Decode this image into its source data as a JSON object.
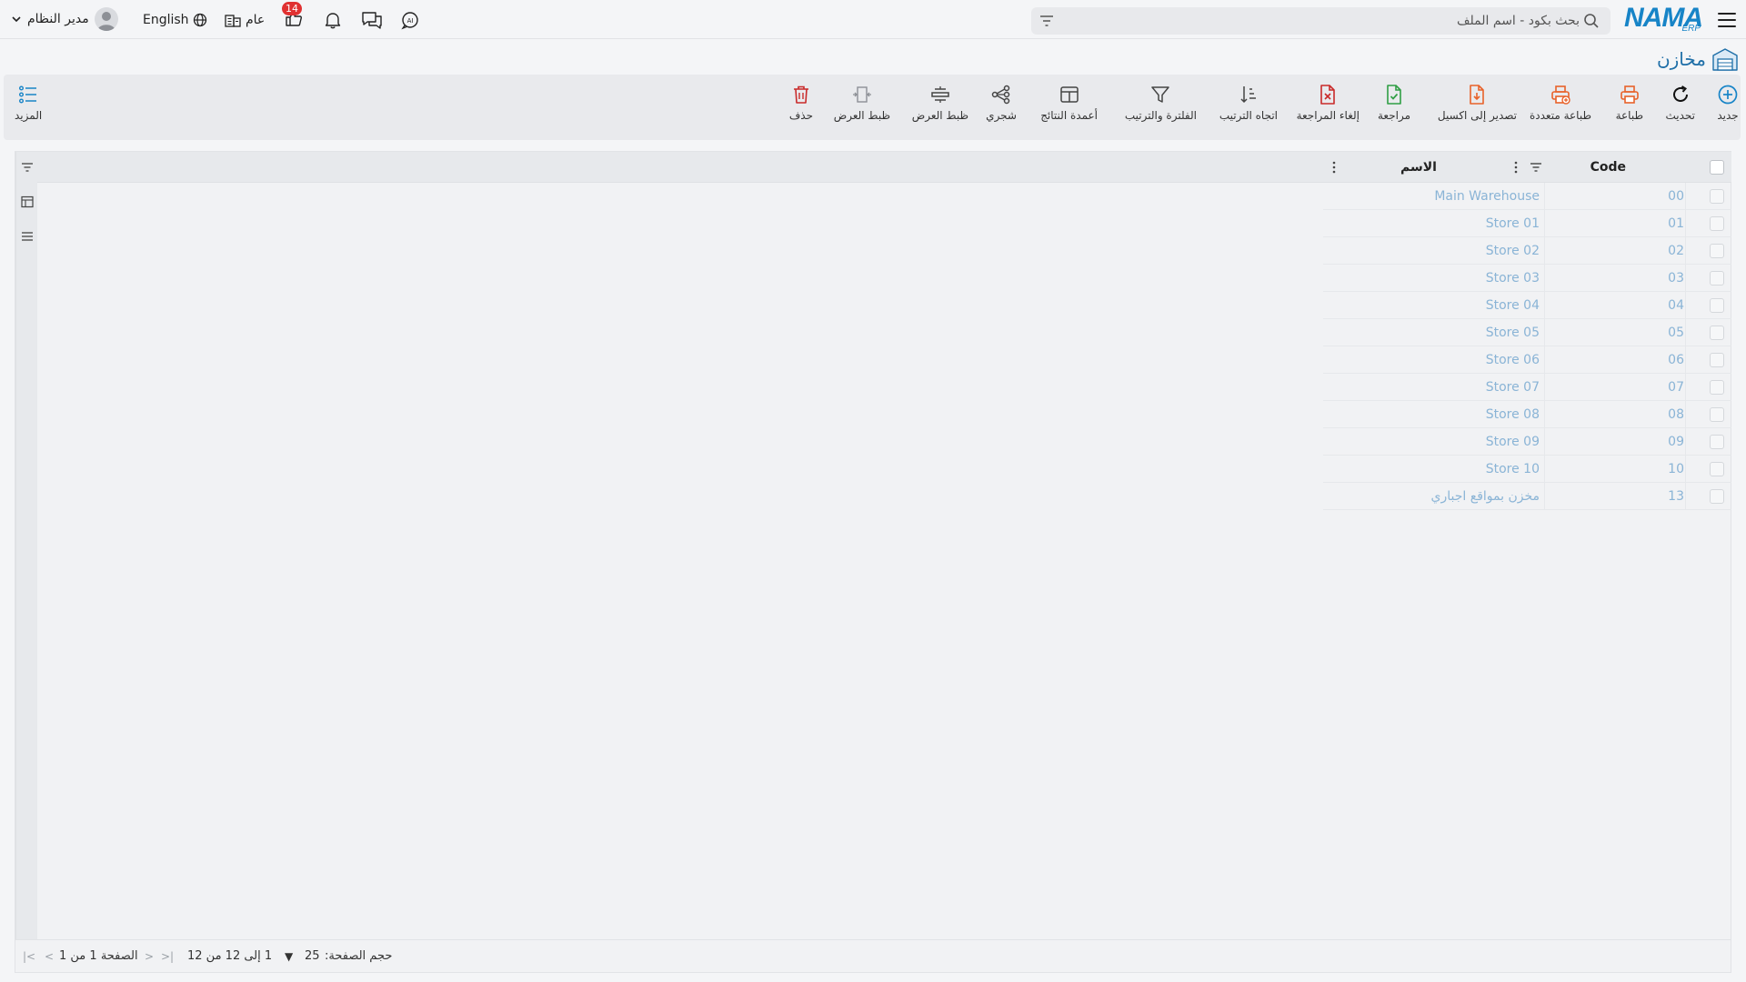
{
  "topbar": {
    "brand": "NAMA",
    "brand_sub": "ERP",
    "search_placeholder": "بحث بكود - اسم الملف",
    "user_name": "مدير النظام",
    "language": "English",
    "general": "عام",
    "notification_count": "14"
  },
  "page": {
    "title": "مخازن"
  },
  "toolbar": {
    "new": "جديد",
    "refresh": "تحديث",
    "print": "طباعة",
    "multi_print": "طباعة متعددة",
    "export_excel": "تصدير إلى اكسيل",
    "review": "مراجعة",
    "cancel_review": "إلغاء المراجعة",
    "sort_direction": "اتجاه الترتيب",
    "filter_sort": "الفلترة والترتيب",
    "result_columns": "أعمدة النتائج",
    "tree": "شجري",
    "view_adjust_1": "ظبط العرض",
    "view_adjust_2": "ظبط العرض",
    "delete": "حذف",
    "more": "المزيد",
    "colors": {
      "new": "#1784c7",
      "print": "#e8622a",
      "review": "#2f9e44",
      "cancel_review": "#c92a2a",
      "delete": "#c92a2a"
    }
  },
  "grid": {
    "columns": {
      "code": "Code",
      "name": "الاسم"
    },
    "rows": [
      {
        "code": "00",
        "name": "Main Warehouse"
      },
      {
        "code": "01",
        "name": "Store 01"
      },
      {
        "code": "02",
        "name": "Store 02"
      },
      {
        "code": "03",
        "name": "Store 03"
      },
      {
        "code": "04",
        "name": "Store 04"
      },
      {
        "code": "05",
        "name": "Store 05"
      },
      {
        "code": "06",
        "name": "Store 06"
      },
      {
        "code": "07",
        "name": "Store 07"
      },
      {
        "code": "08",
        "name": "Store 08"
      },
      {
        "code": "09",
        "name": "Store 09"
      },
      {
        "code": "10",
        "name": "Store 10"
      },
      {
        "code": "13",
        "name": "مخزن بمواقع اجباري"
      }
    ]
  },
  "pager": {
    "page_size_label": "حجم الصفحة:",
    "page_size": "25",
    "range": "1 إلى 12 من 12",
    "page_info": "الصفحة 1 من 1"
  }
}
